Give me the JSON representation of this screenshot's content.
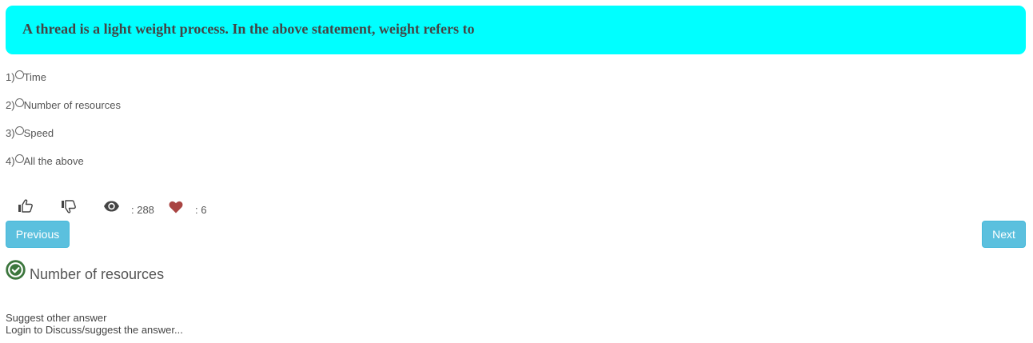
{
  "question": {
    "text": "A thread is a light weight process. In the above statement, weight refers to"
  },
  "options": [
    {
      "number": "1)",
      "label": "Time"
    },
    {
      "number": "2)",
      "label": "Number of resources"
    },
    {
      "number": "3)",
      "label": "Speed"
    },
    {
      "number": "4)",
      "label": "All the above"
    }
  ],
  "stats": {
    "views": ": 288",
    "likes": ": 6",
    "heart_color": "#a94442"
  },
  "nav": {
    "previous_label": "Previous",
    "next_label": "Next"
  },
  "answer": {
    "text": "Number of resources",
    "icon_color": "#3c763d"
  },
  "footer": {
    "suggest": "Suggest other answer",
    "login": "Login to Discuss/suggest the answer..."
  }
}
